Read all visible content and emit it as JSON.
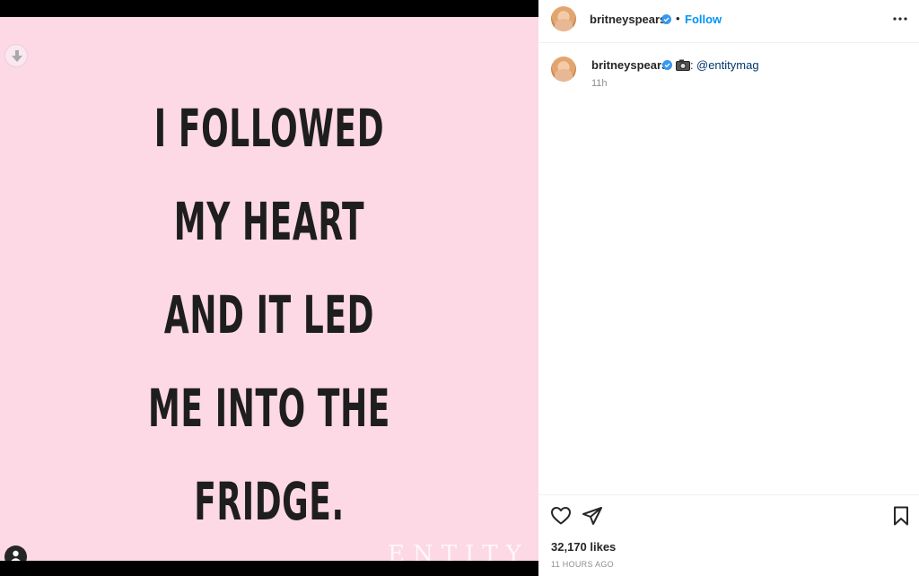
{
  "post": {
    "quote_lines": [
      "I FOLLOWED",
      "MY HEART",
      "AND IT LED",
      "ME INTO THE",
      "FRIDGE."
    ],
    "watermark": "ENTITY",
    "background_color": "#fdd8e5"
  },
  "header": {
    "username": "britneyspears",
    "separator": "•",
    "follow_label": "Follow"
  },
  "caption": {
    "username": "britneyspears",
    "colon": ":",
    "mention": "@entitymag",
    "time": "11h"
  },
  "footer": {
    "likes": "32,170 likes",
    "posted_ago": "11 HOURS AGO"
  },
  "colors": {
    "accent": "#0095f6",
    "verified": "#3897f0",
    "mention": "#00376b"
  }
}
